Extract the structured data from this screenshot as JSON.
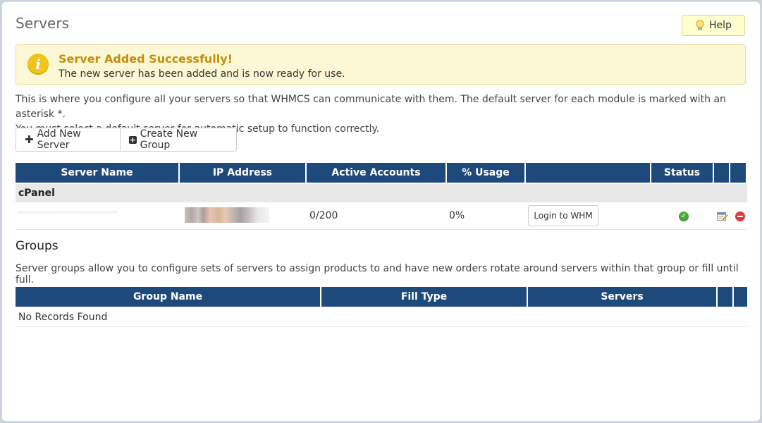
{
  "header": {
    "title": "Servers",
    "help_label": "Help"
  },
  "alert": {
    "title": "Server Added Successfully!",
    "message": "The new server has been added and is now ready for use."
  },
  "intro": {
    "line1": "This is where you configure all your servers so that WHMCS can communicate with them. The default server for each module is marked with an asterisk *.",
    "line2": "You must select a default server for automatic setup to function correctly."
  },
  "actions": {
    "add_server": "Add New Server",
    "create_group": "Create New Group"
  },
  "servers_table": {
    "columns": [
      "Server Name",
      "IP Address",
      "Active Accounts",
      "% Usage",
      "",
      "Status",
      "",
      ""
    ],
    "groups": [
      {
        "name": "cPanel",
        "rows": [
          {
            "active_accounts": "0/200",
            "usage": "0%",
            "login_label": "Login to WHM",
            "status": "active"
          }
        ]
      }
    ]
  },
  "groups_section": {
    "title": "Groups",
    "description": "Server groups allow you to configure sets of servers to assign products to and have new orders rotate around servers within that group or fill until full.",
    "columns": [
      "Group Name",
      "Fill Type",
      "Servers",
      "",
      ""
    ],
    "empty_text": "No Records Found"
  },
  "colors": {
    "table_header": "#1e4a7b",
    "alert_bg": "#fcf8d5",
    "alert_title": "#c48f0b",
    "status_ok": "#4caf3c",
    "delete": "#dd3b3b"
  }
}
